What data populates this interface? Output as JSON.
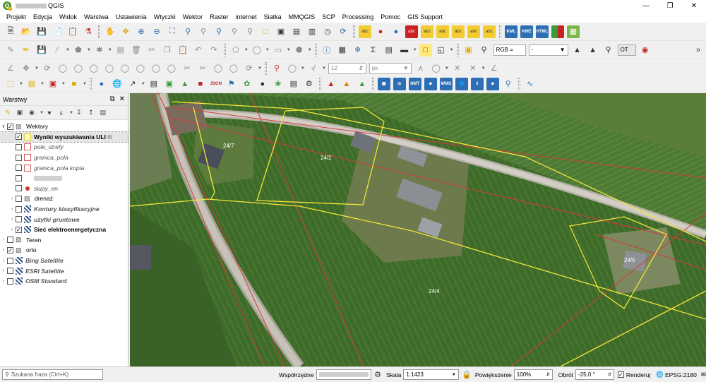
{
  "window": {
    "title": "QGIS",
    "min": "—",
    "max": "❐",
    "close": "✕"
  },
  "menu": [
    "Projekt",
    "Edycja",
    "Widok",
    "Warstwa",
    "Ustawienia",
    "Wtyczki",
    "Wektor",
    "Raster",
    "internet",
    "Siatka",
    "MMQGIS",
    "SCP",
    "Processing",
    "Pomoc",
    "GIS Support"
  ],
  "toolbar": {
    "rgb_label": "RGB =",
    "rgb_value": "-",
    "ot_label": "OT",
    "snap_value": "12",
    "snap_unit": "px",
    "abc_label": "abc",
    "kml_label": "KML",
    "kmz_label": "KMZ",
    "html_label": "HTML",
    "nmt_label": "NMT",
    "wms_label": "WMS",
    "json_label": "JSON"
  },
  "layers_panel": {
    "title": "Warstwy",
    "items": [
      {
        "label": "Wektory",
        "checked": true
      },
      {
        "label": "Wyniki wyszukiwania ULI",
        "checked": true
      },
      {
        "label": "pole_strefy",
        "checked": false
      },
      {
        "label": "granica_pola",
        "checked": false
      },
      {
        "label": "granica_pola kopia",
        "checked": false
      },
      {
        "label": "",
        "checked": false
      },
      {
        "label": "slupy_en",
        "checked": false
      },
      {
        "label": "drenaż",
        "checked": false
      },
      {
        "label": "Kontury klasyfikacyjne",
        "checked": false
      },
      {
        "label": "użytki gruntowe",
        "checked": false
      },
      {
        "label": "Sieć elektroenergetyczna",
        "checked": true
      },
      {
        "label": "Teren",
        "checked": false
      },
      {
        "label": "orto",
        "checked": true
      },
      {
        "label": "Bing Satellite",
        "checked": false
      },
      {
        "label": "ESRI Satellite",
        "checked": false
      },
      {
        "label": "OSM Standard",
        "checked": false
      }
    ]
  },
  "map": {
    "parcel_labels": [
      "24/7",
      "24/2",
      "24/4",
      "24/5"
    ]
  },
  "status": {
    "search_placeholder": "Szukana fraza (Ctrl+K)",
    "coord_label": "Współrzędne",
    "scale_label": "Skala",
    "scale_value": "1:1423",
    "magnifier_label": "Powiększenie",
    "magnifier_value": "100%",
    "rotation_label": "Obrót",
    "rotation_value": "-25,0 °",
    "render_label": "Renderuj",
    "crs_label": "EPSG:2180"
  }
}
